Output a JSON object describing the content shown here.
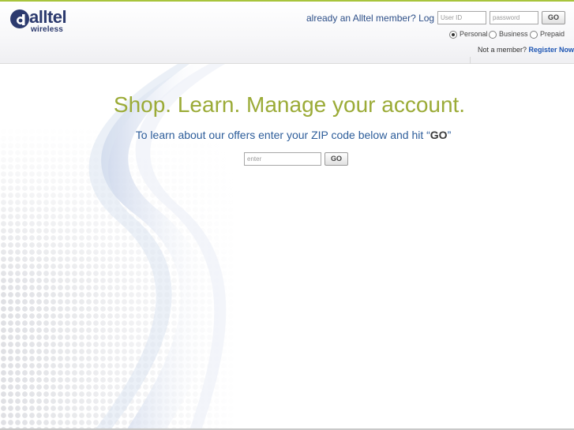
{
  "brand": {
    "name": "alltel",
    "tagline": "wireless",
    "colors": {
      "navy": "#2c3a6e",
      "accent_green": "#9bab37",
      "link_blue": "#1d55b3"
    }
  },
  "login": {
    "prompt": "already an Alltel member? Log In.",
    "userid_placeholder": "User ID",
    "password_placeholder": "password",
    "go_label": "GO",
    "account_types": [
      {
        "label": "Personal",
        "selected": true
      },
      {
        "label": "Business",
        "selected": false
      },
      {
        "label": "Prepaid",
        "selected": false
      }
    ],
    "register_prompt": "Not a member?",
    "register_link": "Register Now"
  },
  "hero": {
    "headline": "Shop. Learn. Manage your account.",
    "subline_pre": "To learn about our offers enter your ZIP code below and hit “",
    "subline_go": "GO",
    "subline_post": "”",
    "zip_placeholder": "enter",
    "go_label": "GO"
  }
}
